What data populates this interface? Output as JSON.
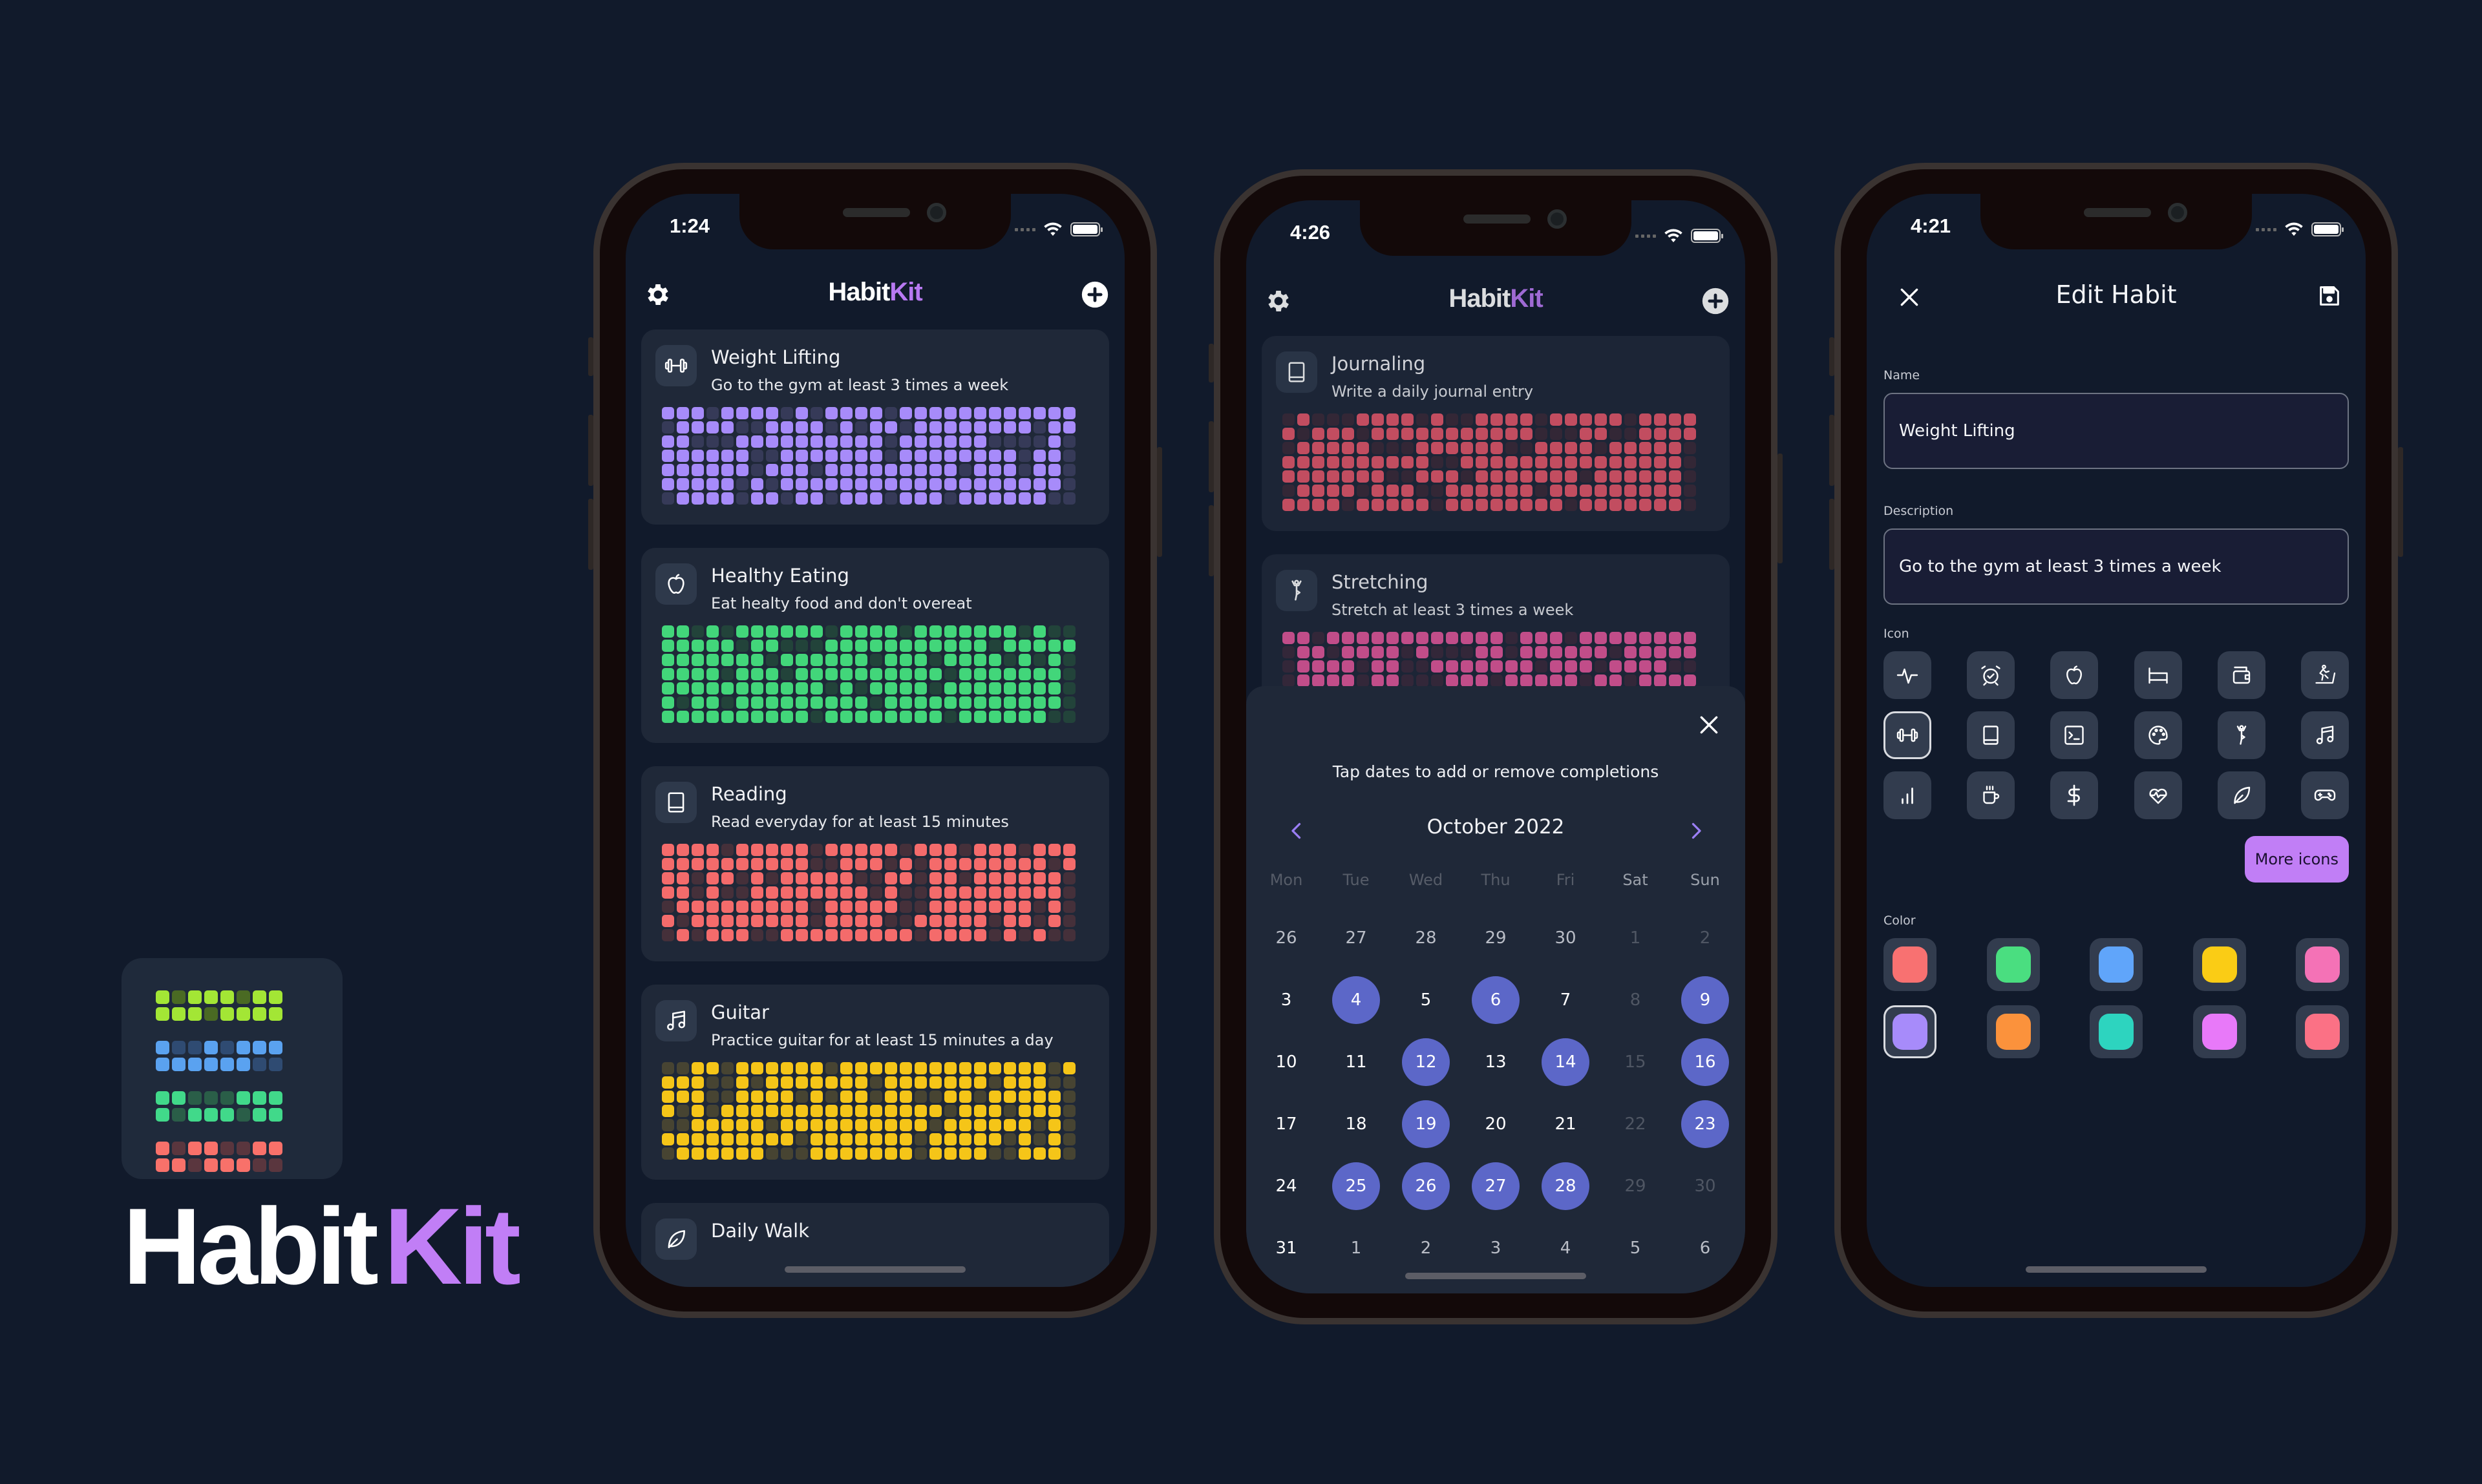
{
  "brand": {
    "word_primary": "Habit",
    "word_accent": "Kit",
    "accent_color": "#c17ef6",
    "logo_grid": {
      "rows": [
        {
          "color": "#a3e635",
          "dim": "#4a6a23",
          "pattern": "10111011"
        },
        {
          "color": "#a3e635",
          "dim": "#4a6a23",
          "pattern": "11101111"
        },
        {
          "color": "#5aa2f0",
          "dim": "#2f4b72",
          "pattern": "10010111"
        },
        {
          "color": "#5aa2f0",
          "dim": "#2f4b72",
          "pattern": "11111100"
        },
        {
          "color": "#41d98a",
          "dim": "#2a5e48",
          "pattern": "11000111"
        },
        {
          "color": "#41d98a",
          "dim": "#2a5e48",
          "pattern": "10111011"
        },
        {
          "color": "#f8716a",
          "dim": "#5a363e",
          "pattern": "10110011"
        },
        {
          "color": "#f8716a",
          "dim": "#5a363e",
          "pattern": "11011100"
        }
      ]
    }
  },
  "phone_home": {
    "status": {
      "time": "1:24"
    },
    "header": {
      "title_primary": "Habit",
      "title_accent": "Kit",
      "left_icon": "gear-icon",
      "right_icon": "plus-circle-icon"
    },
    "habits": [
      {
        "name": "Weight Lifting",
        "description": "Go to the gym at least 3 times a week",
        "icon": "dumbbell-icon",
        "color": "#a78bfa",
        "dim": "#363a58",
        "grid": [
          "1110111101011110111111111111",
          "0111100111101011011111111011",
          "1100011111111110111111000010",
          "1111110011111110111111110110",
          "1111110111011111111101110110",
          "1111101011111111111111111110",
          "0111101101101110111011111100"
        ]
      },
      {
        "name": "Healthy Eating",
        "description": "Eat healty food and don't overeat",
        "icon": "apple-icon",
        "color": "#42d67a",
        "dim": "#22433a",
        "grid": [
          "1101011111101111011111110100",
          "1111101100011111111111011111",
          "1111111011111101110111101010",
          "1111011101111111111011111110",
          "1111111111101011110111111110",
          "1011011111111101111111111110",
          "1111111111011111111011111100"
        ]
      },
      {
        "name": "Reading",
        "description": "Read everyday for at least 15 minutes",
        "icon": "book-icon",
        "color": "#f46b6b",
        "dim": "#45303a",
        "grid": [
          "1111011111011111011101110111",
          "1111111111001110101111111101",
          "1101101011111001101101111110",
          "1101001111111101001111111110",
          "0111111111011111001111111010",
          "1011111111011110011111011010",
          "0101110011111111101111010100"
        ]
      },
      {
        "name": "Guitar",
        "description": "Practice guitar for at least 15 minutes a day",
        "icon": "music-icon",
        "color": "#f5c518",
        "dim": "#474432",
        "grid": [
          "0011011111101111111111111101",
          "1110010111111101111111011100",
          "1110011110101101100110111110",
          "1010111111111111111011101110",
          "0011111011111111110111111010",
          "1111111110111111101111101010",
          "0111111000111111101111001110"
        ]
      },
      {
        "name": "Daily Walk",
        "description": "",
        "icon": "leaf-icon",
        "color": "#42d67a",
        "dim": "#22433a",
        "grid": []
      }
    ]
  },
  "phone_calendar": {
    "status": {
      "time": "4:26"
    },
    "header": {
      "title_primary": "Habit",
      "title_accent": "Kit"
    },
    "habits": [
      {
        "name": "Journaling",
        "description": "Write a daily journal entry",
        "icon": "book-icon",
        "color": "#e2576a",
        "dim": "#3a2a38",
        "grid": [
          "0100011110100111101111101111",
          "1011101111111111100011001111",
          "0111110001111110011110111110",
          "1111111111001111111111111110",
          "1111111001110111111101111110",
          "0111101110011111101111111110",
          "1111011111011111111011111110"
        ]
      },
      {
        "name": "Stretching",
        "description": "Stretch at least 3 times a week",
        "icon": "yoga-icon",
        "color": "#e0579a",
        "dim": "#3a2a3c",
        "grid": [
          "1101111111111110111011111111",
          "0110111101000110111111011111",
          "0111101100111111101110111100",
          "0111101100011101111101101111",
          "0111101101000111111110111110",
          "1111111111111111111111111110",
          "1111111111111111111111111110"
        ]
      }
    ],
    "sheet": {
      "hint": "Tap dates to add or remove completions",
      "month_label": "October 2022",
      "prev_icon": "chevron-left-icon",
      "next_icon": "chevron-right-icon",
      "close_icon": "close-icon",
      "completion_color": "#5c67c8",
      "weekdays": [
        "Mon",
        "Tue",
        "Wed",
        "Thu",
        "Fri",
        "Sat",
        "Sun"
      ],
      "days": [
        {
          "d": "26",
          "s": "other"
        },
        {
          "d": "27",
          "s": "other"
        },
        {
          "d": "28",
          "s": "other"
        },
        {
          "d": "29",
          "s": "other"
        },
        {
          "d": "30",
          "s": "other"
        },
        {
          "d": "1",
          "s": "faded"
        },
        {
          "d": "2",
          "s": "faded"
        },
        {
          "d": "3",
          "s": "normal"
        },
        {
          "d": "4",
          "s": "done"
        },
        {
          "d": "5",
          "s": "normal"
        },
        {
          "d": "6",
          "s": "done"
        },
        {
          "d": "7",
          "s": "normal"
        },
        {
          "d": "8",
          "s": "faded"
        },
        {
          "d": "9",
          "s": "done"
        },
        {
          "d": "10",
          "s": "normal"
        },
        {
          "d": "11",
          "s": "normal"
        },
        {
          "d": "12",
          "s": "done"
        },
        {
          "d": "13",
          "s": "normal"
        },
        {
          "d": "14",
          "s": "done"
        },
        {
          "d": "15",
          "s": "faded"
        },
        {
          "d": "16",
          "s": "done"
        },
        {
          "d": "17",
          "s": "normal"
        },
        {
          "d": "18",
          "s": "normal"
        },
        {
          "d": "19",
          "s": "done"
        },
        {
          "d": "20",
          "s": "normal"
        },
        {
          "d": "21",
          "s": "normal"
        },
        {
          "d": "22",
          "s": "faded"
        },
        {
          "d": "23",
          "s": "done"
        },
        {
          "d": "24",
          "s": "normal"
        },
        {
          "d": "25",
          "s": "done"
        },
        {
          "d": "26",
          "s": "done"
        },
        {
          "d": "27",
          "s": "done"
        },
        {
          "d": "28",
          "s": "done"
        },
        {
          "d": "29",
          "s": "faded"
        },
        {
          "d": "30",
          "s": "faded"
        },
        {
          "d": "31",
          "s": "normal"
        },
        {
          "d": "1",
          "s": "other"
        },
        {
          "d": "2",
          "s": "other"
        },
        {
          "d": "3",
          "s": "other"
        },
        {
          "d": "4",
          "s": "other"
        },
        {
          "d": "5",
          "s": "other"
        },
        {
          "d": "6",
          "s": "other"
        }
      ]
    }
  },
  "phone_edit": {
    "status": {
      "time": "4:21"
    },
    "header": {
      "title": "Edit Habit",
      "close_icon": "close-icon",
      "save_icon": "save-icon"
    },
    "form": {
      "name_label": "Name",
      "name_value": "Weight Lifting",
      "description_label": "Description",
      "description_value": "Go to the gym at least 3 times a week",
      "icon_label": "Icon",
      "icons": [
        {
          "name": "activity-icon",
          "selected": false
        },
        {
          "name": "alarm-clock-icon",
          "selected": false
        },
        {
          "name": "apple-icon",
          "selected": false
        },
        {
          "name": "bed-icon",
          "selected": false
        },
        {
          "name": "wallet-icon",
          "selected": false
        },
        {
          "name": "treadmill-icon",
          "selected": false
        },
        {
          "name": "dumbbell-icon",
          "selected": true
        },
        {
          "name": "book-icon",
          "selected": false
        },
        {
          "name": "terminal-icon",
          "selected": false
        },
        {
          "name": "palette-icon",
          "selected": false
        },
        {
          "name": "yoga-icon",
          "selected": false
        },
        {
          "name": "music-icon",
          "selected": false
        },
        {
          "name": "bar-chart-icon",
          "selected": false
        },
        {
          "name": "coffee-icon",
          "selected": false
        },
        {
          "name": "dollar-icon",
          "selected": false
        },
        {
          "name": "heart-pulse-icon",
          "selected": false
        },
        {
          "name": "leaf-icon",
          "selected": false
        },
        {
          "name": "gamepad-icon",
          "selected": false
        }
      ],
      "more_icons_label": "More icons",
      "color_label": "Color",
      "colors": [
        {
          "hex": "#f87171",
          "selected": false
        },
        {
          "hex": "#4ade80",
          "selected": false
        },
        {
          "hex": "#60a5fa",
          "selected": false
        },
        {
          "hex": "#facc15",
          "selected": false
        },
        {
          "hex": "#f472b6",
          "selected": false
        },
        {
          "hex": "#a78bfa",
          "selected": true
        },
        {
          "hex": "#fb923c",
          "selected": false
        },
        {
          "hex": "#2dd4bf",
          "selected": false
        },
        {
          "hex": "#e879f9",
          "selected": false
        },
        {
          "hex": "#fb7185",
          "selected": false
        }
      ]
    }
  }
}
